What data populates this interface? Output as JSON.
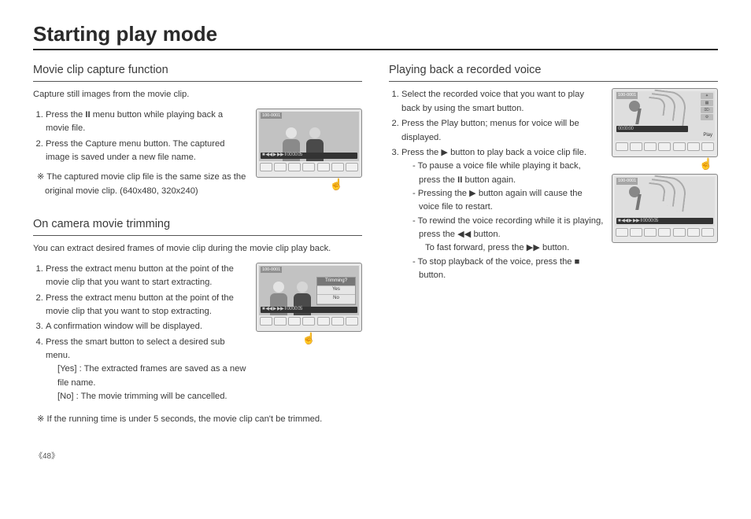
{
  "page": {
    "title": "Starting play mode",
    "number": "48"
  },
  "movie_capture": {
    "title": "Movie clip capture function",
    "intro": "Capture still images from the movie clip.",
    "step1_pre": "Press the ",
    "step1_bold": "II",
    "step1_post": " menu button while playing back a movie file.",
    "step2": "Press the Capture menu button. The captured image is saved under a new file name.",
    "note": "※ The captured movie clip file is the same size as the original movie clip. (640x480, 320x240)"
  },
  "trimming": {
    "title": "On camera movie trimming",
    "intro": "You can extract desired  frames of movie clip during the movie clip play back.",
    "step1": "Press the extract menu button at the point of the movie clip that you want to start extracting.",
    "step2": "Press the extract menu button at the point of the movie clip that you want to stop extracting.",
    "step3": "A confirmation window will be displayed.",
    "step4": "Press the smart button to select a desired sub menu.",
    "yes_text": "[Yes]  : The extracted frames are saved as a new file name.",
    "no_text": "[No]   : The movie trimming will be cancelled.",
    "note": "※ If the running time is under 5 seconds, the movie clip can't be trimmed.",
    "dialog": {
      "title": "Trimming?",
      "yes": "Yes",
      "no": "No"
    }
  },
  "voice": {
    "title": "Playing back a recorded voice",
    "step1": "Select the recorded voice that you want to play back by using the smart button.",
    "step2": "Press the Play button; menus for voice will be displayed.",
    "step3": "Press the  ▶  button to play back a voice clip file.",
    "s3a_pre": "- To pause a voice file while playing it back, press the ",
    "s3a_bold": "II",
    "s3a_post": " button again.",
    "s3b": "- Pressing the  ▶  button again will cause the voice file to restart.",
    "s3c": "- To rewind the voice recording while it is playing, press the  ◀◀  button.",
    "s3c_line2": "To fast forward, press the  ▶▶  button.",
    "s3d": "- To stop playback of the voice, press the  ■  button."
  },
  "lcd": {
    "clip_id": "100-0001",
    "play_label": "Play",
    "botbar": "■  ◀◀  ▶  ▶▶  ‖  00:00:05",
    "time": "00:00:00"
  }
}
